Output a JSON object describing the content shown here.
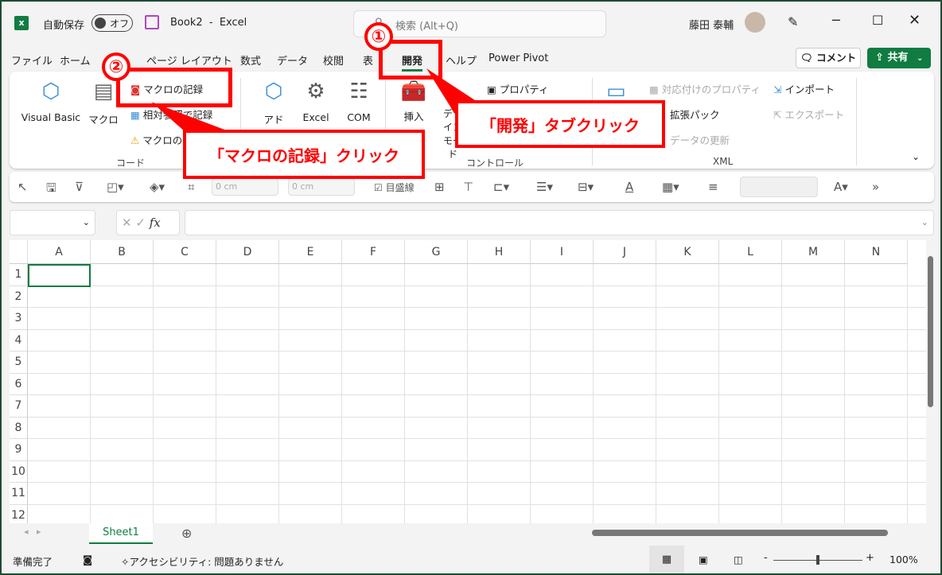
{
  "title_bar": {
    "autosave_label": "自動保存",
    "autosave_state": "オフ",
    "doc_title": "Book2  -  Excel",
    "search_placeholder": "検索 (Alt+Q)",
    "user_name": "藤田 泰輔"
  },
  "tabs": [
    {
      "label": "ファイル"
    },
    {
      "label": "ホーム"
    },
    {
      "label": "ページ レイアウト"
    },
    {
      "label": "数式"
    },
    {
      "label": "データ"
    },
    {
      "label": "校閲"
    },
    {
      "label": "表"
    },
    {
      "label": "開発",
      "active": true
    },
    {
      "label": "ヘルプ"
    },
    {
      "label": "Power Pivot"
    }
  ],
  "comment_button": "コメント",
  "share_button": "共有",
  "ribbon": {
    "code": {
      "group": "コード",
      "visual_basic": "Visual Basic",
      "macro": "マクロ",
      "record_macro": "マクロの記録",
      "relative": "相対参照で記録",
      "security": "マクロのセキュリティ"
    },
    "addins": {
      "addin": "アド",
      "excel": "Excel",
      "com": "COM"
    },
    "controls": {
      "group": "コントロール",
      "insert": "挿入",
      "design": "デザイン モード",
      "properties": "プロパティ"
    },
    "xml": {
      "group": "XML",
      "map_props": "対応付けのプロパティ",
      "expansion": "拡張パック",
      "refresh": "データの更新",
      "import": "インポート",
      "export": "エクスポート"
    }
  },
  "toolbar": {
    "width1": "0 cm",
    "width2": "0 cm",
    "gridlines": "目盛線"
  },
  "formula_bar": {
    "name_box": "",
    "formula": "",
    "fx": "fx"
  },
  "columns": [
    "A",
    "B",
    "C",
    "D",
    "E",
    "F",
    "G",
    "H",
    "I",
    "J",
    "K",
    "L",
    "M",
    "N"
  ],
  "rows": [
    "1",
    "2",
    "3",
    "4",
    "5",
    "6",
    "7",
    "8",
    "9",
    "10",
    "11",
    "12"
  ],
  "sheet_tab": "Sheet1",
  "status": {
    "ready": "準備完了",
    "accessibility": "アクセシビリティ: 問題ありません",
    "zoom": "100%",
    "zoom_percent": 100
  },
  "annotations": {
    "step1": "①",
    "step1_text": "「開発」タブクリック",
    "step2": "②",
    "step2_text": "「マクロの記録」クリック",
    "color": "#ff0000"
  },
  "colors": {
    "accent": "#107c41",
    "frame": "#1e4b33"
  }
}
